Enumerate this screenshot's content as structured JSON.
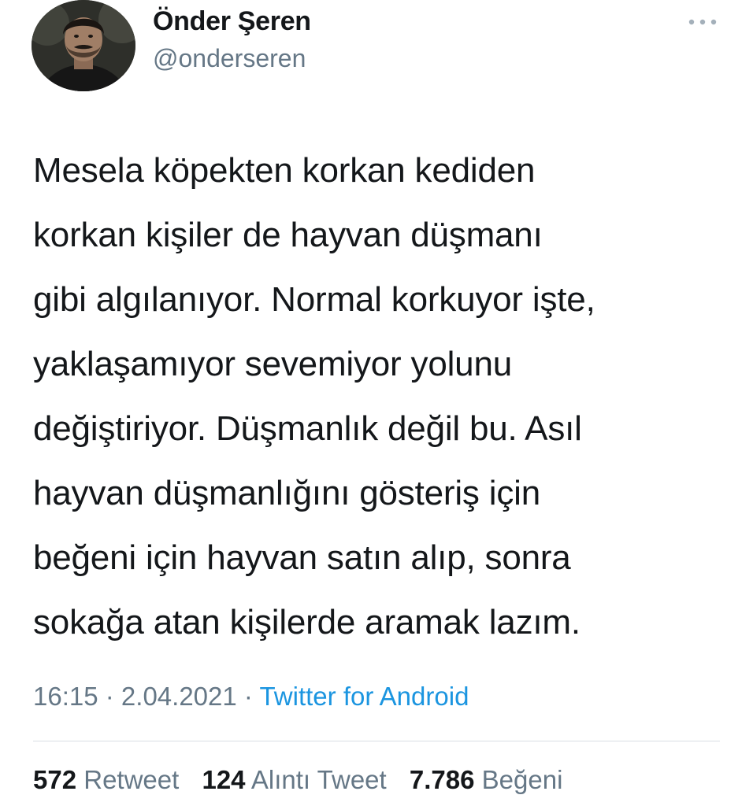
{
  "user": {
    "display_name": "Önder Şeren",
    "handle": "@onderseren"
  },
  "tweet": {
    "lines": [
      "Mesela köpekten korkan kediden",
      "korkan kişiler de hayvan düşmanı",
      "gibi algılanıyor. Normal korkuyor işte,",
      "yaklaşamıyor sevemiyor yolunu",
      "değiştiriyor. Düşmanlık değil bu. Asıl",
      "hayvan düşmanlığını gösteriş için",
      "beğeni için hayvan satın alıp, sonra",
      "sokağa atan kişilerde aramak lazım."
    ],
    "time": "16:15",
    "date": "2.04.2021",
    "separator": " · ",
    "source": "Twitter for Android"
  },
  "stats": {
    "retweet_count": "572",
    "retweet_label": "Retweet",
    "quote_count": "124",
    "quote_label": "Alıntı Tweet",
    "like_count": "7.786",
    "like_label": "Beğeni"
  },
  "icons": {
    "more": "more-horizontal-icon",
    "avatar": "profile-avatar"
  },
  "colors": {
    "text": "#14171a",
    "muted": "#657786",
    "link": "#1b95e0",
    "divider": "#d8dee3"
  }
}
